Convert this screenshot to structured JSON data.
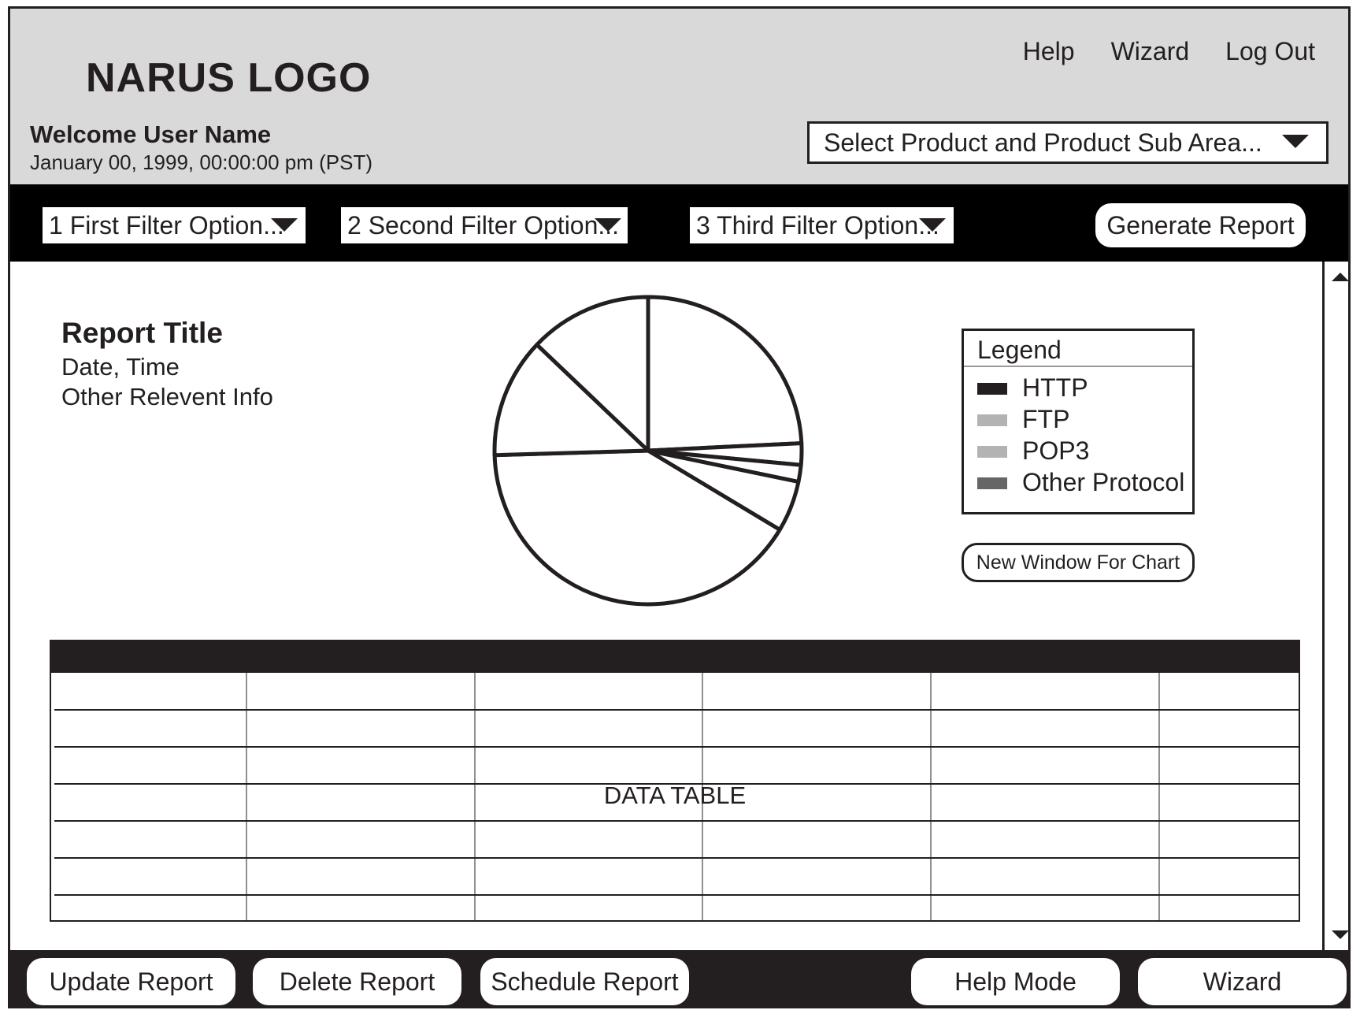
{
  "header": {
    "logo": "NARUS LOGO",
    "links": [
      "Help",
      "Wizard",
      "Log Out"
    ],
    "welcome": "Welcome User Name",
    "datetime": "January 00, 1999, 00:00:00 pm (PST)",
    "product_select": "Select Product and Product Sub Area..."
  },
  "filters": {
    "first": "1  First Filter Option...",
    "second": "2  Second Filter Option...",
    "third": "3  Third Filter Option...",
    "generate": "Generate Report"
  },
  "report": {
    "title": "Report Title",
    "date_time": "Date, Time",
    "other_info": "Other Relevent Info"
  },
  "legend": {
    "title": "Legend",
    "items": [
      {
        "label": "HTTP",
        "color": "#231f20"
      },
      {
        "label": "FTP",
        "color": "#b3b3b3"
      },
      {
        "label": "POP3",
        "color": "#b3b3b3"
      },
      {
        "label": "Other Protocol",
        "color": "#666666"
      }
    ]
  },
  "new_window_button": "New Window For Chart",
  "table": {
    "label": "DATA TABLE",
    "columns": 6,
    "rows": 7
  },
  "footer": {
    "update": "Update Report",
    "delete": "Delete Report",
    "schedule": "Schedule Report",
    "help_mode": "Help Mode",
    "wizard": "Wizard"
  },
  "chart_data": {
    "type": "pie",
    "title": "",
    "slices_percent": [
      23.5,
      2.2,
      1.7,
      5.2,
      39.7,
      12.2,
      12.5
    ],
    "legend": [
      "HTTP",
      "FTP",
      "POP3",
      "Other Protocol"
    ]
  }
}
